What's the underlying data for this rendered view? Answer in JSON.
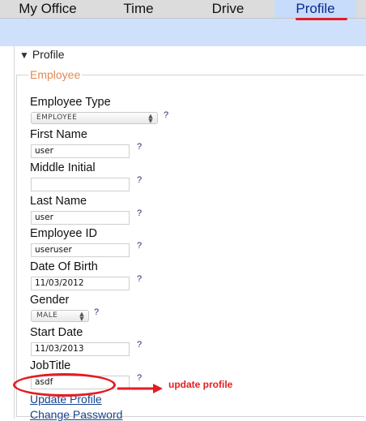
{
  "tabs": [
    {
      "label": "My Office"
    },
    {
      "label": "Time"
    },
    {
      "label": "Drive"
    },
    {
      "label": "Profile"
    }
  ],
  "section": {
    "title": "Profile"
  },
  "group": {
    "title": "Employee"
  },
  "fields": {
    "employee_type": {
      "label": "Employee Type",
      "value": "EMPLOYEE"
    },
    "first_name": {
      "label": "First Name",
      "value": "user"
    },
    "middle_initial": {
      "label": "Middle Initial",
      "value": ""
    },
    "last_name": {
      "label": "Last Name",
      "value": "user"
    },
    "employee_id": {
      "label": "Employee ID",
      "value": "useruser"
    },
    "date_of_birth": {
      "label": "Date Of Birth",
      "value": "11/03/2012"
    },
    "gender": {
      "label": "Gender",
      "value": "MALE"
    },
    "start_date": {
      "label": "Start Date",
      "value": "11/03/2013"
    },
    "job_title": {
      "label": "JobTitle",
      "value": "asdf"
    }
  },
  "help": "?",
  "links": {
    "update_profile": "Update Profile",
    "change_password": "Change Password"
  },
  "annotation": {
    "text": "update profile",
    "color": "#e31d22"
  },
  "colors": {
    "active_tab_bg": "#c7dbfb",
    "banner_bg": "#cfe0fb",
    "legend_color": "#e38a56",
    "link_color": "#17448f"
  }
}
